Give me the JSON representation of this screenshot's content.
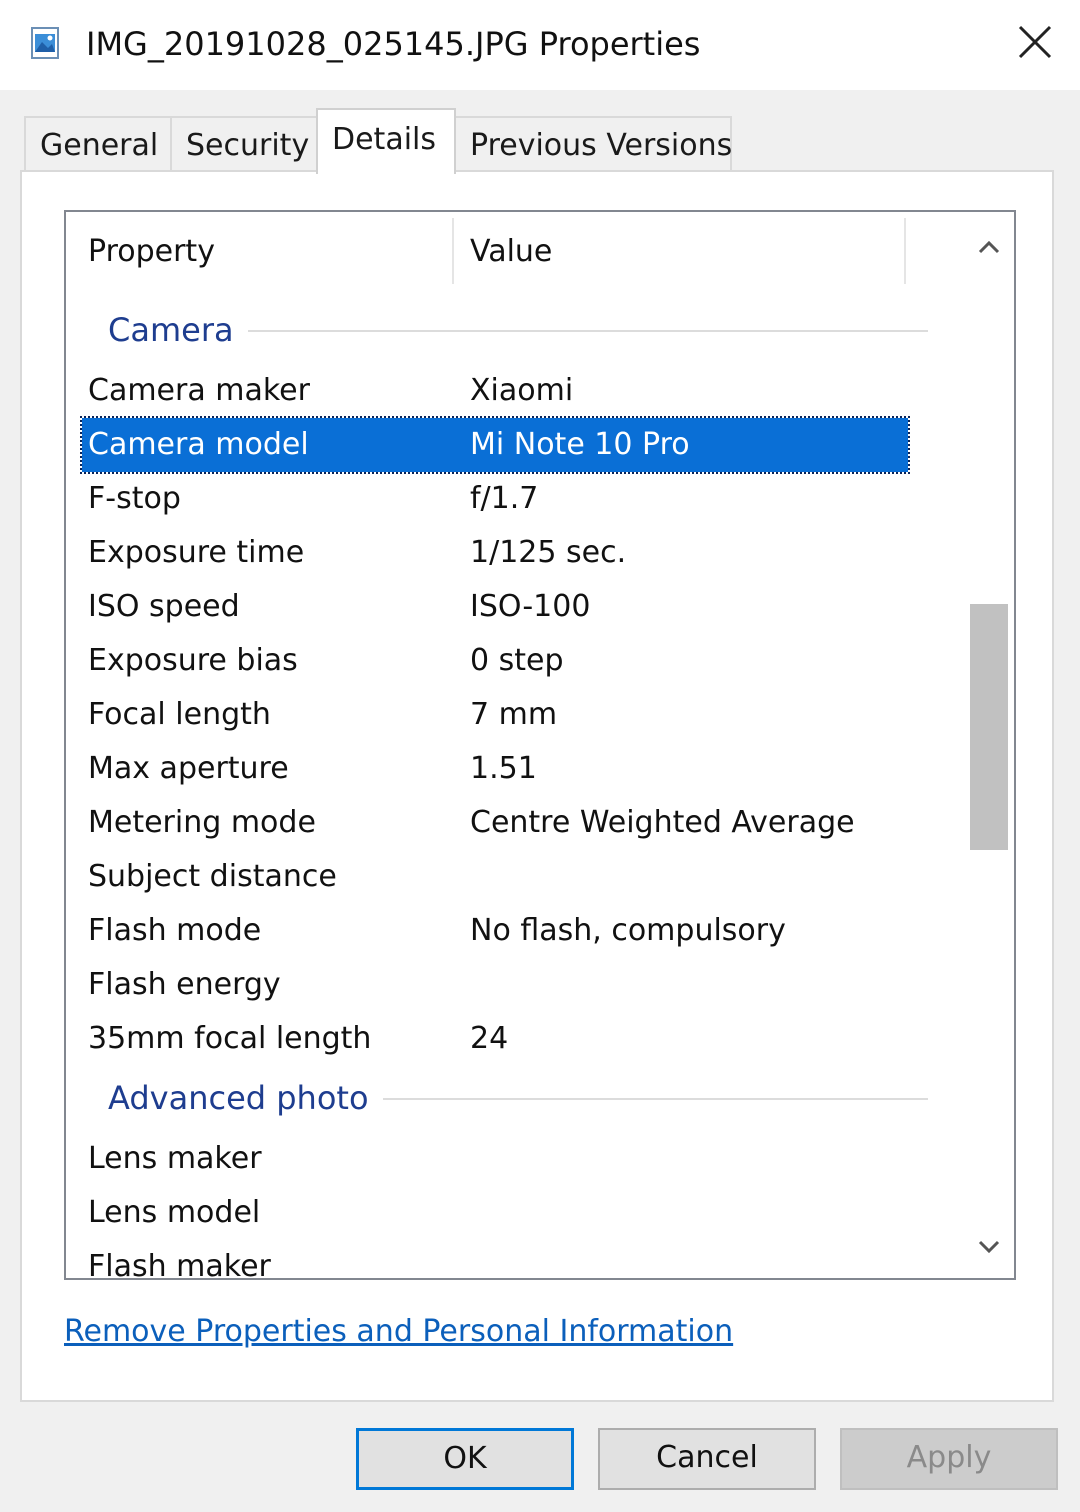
{
  "window": {
    "title": "IMG_20191028_025145.JPG Properties"
  },
  "tabs": [
    {
      "label": "General",
      "active": false
    },
    {
      "label": "Security",
      "active": false
    },
    {
      "label": "Details",
      "active": true
    },
    {
      "label": "Previous Versions",
      "active": false
    }
  ],
  "list": {
    "columns": {
      "property": "Property",
      "value": "Value"
    },
    "groups": [
      {
        "title": "Camera",
        "rows": [
          {
            "property": "Camera maker",
            "value": "Xiaomi"
          },
          {
            "property": "Camera model",
            "value": "Mi Note 10 Pro",
            "selected": true
          },
          {
            "property": "F-stop",
            "value": "f/1.7"
          },
          {
            "property": "Exposure time",
            "value": "1/125 sec."
          },
          {
            "property": "ISO speed",
            "value": "ISO-100"
          },
          {
            "property": "Exposure bias",
            "value": "0 step"
          },
          {
            "property": "Focal length",
            "value": "7 mm"
          },
          {
            "property": "Max aperture",
            "value": "1.51"
          },
          {
            "property": "Metering mode",
            "value": "Centre Weighted Average"
          },
          {
            "property": "Subject distance",
            "value": ""
          },
          {
            "property": "Flash mode",
            "value": "No flash, compulsory"
          },
          {
            "property": "Flash energy",
            "value": ""
          },
          {
            "property": "35mm focal length",
            "value": "24"
          }
        ]
      },
      {
        "title": "Advanced photo",
        "rows": [
          {
            "property": "Lens maker",
            "value": ""
          },
          {
            "property": "Lens model",
            "value": ""
          },
          {
            "property": "Flash maker",
            "value": ""
          }
        ]
      }
    ]
  },
  "link": {
    "label": "Remove Properties and Personal Information"
  },
  "buttons": {
    "ok": "OK",
    "cancel": "Cancel",
    "apply": "Apply"
  },
  "colors": {
    "selection": "#0a6fd6",
    "group_header": "#1e3d8f",
    "link": "#0b5fbb",
    "ok_border": "#0078d7"
  },
  "icons": {
    "title": "image-file-icon",
    "close": "close-icon",
    "scroll_up": "chevron-up-icon",
    "scroll_down": "chevron-down-icon"
  }
}
